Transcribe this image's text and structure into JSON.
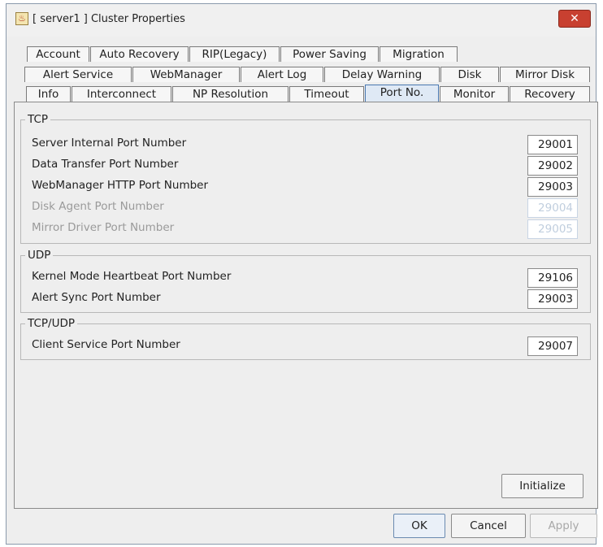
{
  "window": {
    "title": "[ server1 ] Cluster Properties",
    "close_label": "✕"
  },
  "tabs": {
    "row1": [
      "Account",
      "Auto Recovery",
      "RIP(Legacy)",
      "Power Saving",
      "Migration"
    ],
    "row2": [
      "Alert Service",
      "WebManager",
      "Alert Log",
      "Delay Warning",
      "Disk",
      "Mirror Disk"
    ],
    "row3": [
      "Info",
      "Interconnect",
      "NP Resolution",
      "Timeout",
      "Port No.",
      "Monitor",
      "Recovery"
    ],
    "active": "Port No."
  },
  "tcp": {
    "title": "TCP",
    "rows": [
      {
        "label": "Server Internal Port Number",
        "value": "29001",
        "enabled": true
      },
      {
        "label": "Data Transfer Port Number",
        "value": "29002",
        "enabled": true
      },
      {
        "label": "WebManager HTTP Port Number",
        "value": "29003",
        "enabled": true
      },
      {
        "label": "Disk Agent Port Number",
        "value": "29004",
        "enabled": false
      },
      {
        "label": "Mirror Driver Port Number",
        "value": "29005",
        "enabled": false
      }
    ]
  },
  "udp": {
    "title": "UDP",
    "rows": [
      {
        "label": "Kernel Mode Heartbeat Port Number",
        "value": "29106",
        "enabled": true
      },
      {
        "label": "Alert Sync Port Number",
        "value": "29003",
        "enabled": true
      }
    ]
  },
  "tcpudp": {
    "title": "TCP/UDP",
    "rows": [
      {
        "label": "Client Service Port Number",
        "value": "29007",
        "enabled": true
      }
    ]
  },
  "buttons": {
    "initialize": "Initialize",
    "ok": "OK",
    "cancel": "Cancel",
    "apply": "Apply"
  }
}
